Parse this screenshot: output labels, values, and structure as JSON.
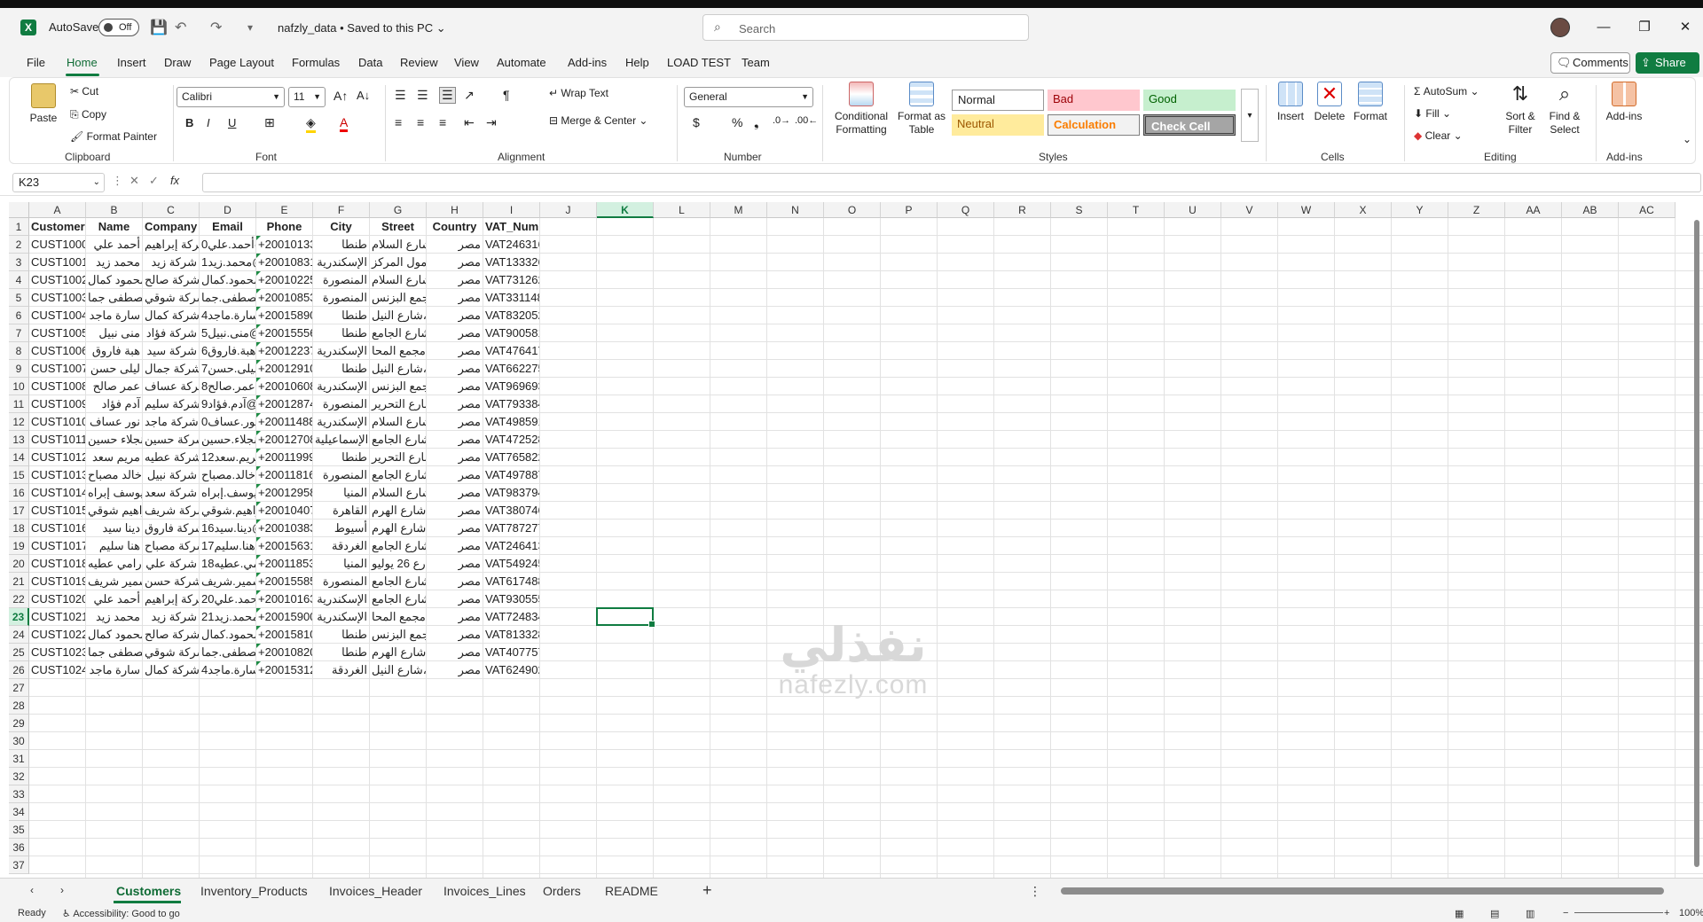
{
  "title_bar": {
    "autosave_label": "AutoSave",
    "autosave_state": "Off",
    "doc_title": "nafzly_data • Saved to this PC ⌄",
    "search_placeholder": "Search"
  },
  "menu": {
    "items": [
      "File",
      "Home",
      "Insert",
      "Draw",
      "Page Layout",
      "Formulas",
      "Data",
      "Review",
      "View",
      "Automate",
      "Add-ins",
      "Help",
      "LOAD TEST",
      "Team"
    ],
    "active": "Home",
    "comments": "Comments",
    "share": "Share"
  },
  "ribbon": {
    "clipboard": {
      "paste": "Paste",
      "cut": "Cut",
      "copy": "Copy",
      "format_painter": "Format Painter",
      "label": "Clipboard"
    },
    "font": {
      "name": "Calibri",
      "size": "11",
      "label": "Font"
    },
    "alignment": {
      "wrap": "Wrap Text",
      "merge": "Merge & Center",
      "label": "Alignment"
    },
    "number": {
      "format": "General",
      "label": "Number"
    },
    "styles": {
      "conditional": "Conditional Formatting",
      "format_as_table": "Format as Table",
      "normal": "Normal",
      "bad": "Bad",
      "good": "Good",
      "neutral": "Neutral",
      "calculation": "Calculation",
      "check_cell": "Check Cell",
      "label": "Styles"
    },
    "cells": {
      "insert": "Insert",
      "delete": "Delete",
      "format": "Format",
      "label": "Cells"
    },
    "editing": {
      "autosum": "AutoSum",
      "fill": "Fill",
      "clear": "Clear",
      "sort": "Sort & Filter",
      "find": "Find & Select",
      "label": "Editing"
    },
    "addins": {
      "addins": "Add-ins",
      "label": "Add-ins"
    }
  },
  "formula_bar": {
    "name_box": "K23",
    "formula": ""
  },
  "grid": {
    "columns": [
      "A",
      "B",
      "C",
      "D",
      "E",
      "F",
      "G",
      "H",
      "I",
      "J",
      "K",
      "L",
      "M",
      "N",
      "O",
      "P",
      "Q",
      "R",
      "S",
      "T",
      "U",
      "V",
      "W",
      "X",
      "Y",
      "Z",
      "AA",
      "AB",
      "AC"
    ],
    "row_numbers": [
      "1",
      "2",
      "3",
      "4",
      "5",
      "6",
      "7",
      "8",
      "9",
      "10",
      "11",
      "12",
      "13",
      "14",
      "15",
      "16",
      "17",
      "18",
      "19",
      "20",
      "21",
      "22",
      "23",
      "24",
      "25",
      "26",
      "27",
      "28",
      "29",
      "30",
      "31",
      "32",
      "33",
      "34",
      "35",
      "36",
      "37"
    ],
    "selected_cell": "K23",
    "headers": [
      "CustomerID",
      "Name",
      "Company",
      "Email",
      "Phone",
      "City",
      "Street",
      "Country",
      "VAT_Number"
    ],
    "rows": [
      [
        "CUST1000",
        "أحمد علي",
        "شركة إبراهيم",
        "أحمد.علي0@",
        "+20010133",
        "طنطا",
        "شارع السلام",
        "مصر",
        "VAT246316"
      ],
      [
        "CUST1001",
        "محمد زيد",
        "شركة زيد",
        "محمد.زيد1@",
        "+20010831",
        "الإسكندرية",
        "مول المركز",
        "مصر",
        "VAT133326"
      ],
      [
        "CUST1002",
        "محمود كمال",
        "شركة صالح",
        "محمود.كمال",
        "+20010225",
        "المنصورة",
        "شارع السلام",
        "مصر",
        "VAT731262"
      ],
      [
        "CUST1003",
        "مصطفى جما",
        "شركة شوقي",
        "مصطفى.جما",
        "+20010853",
        "المنصورة",
        "مجمع البزنس",
        "مصر",
        "VAT331148"
      ],
      [
        "CUST1004",
        "سارة ماجد",
        "شركة كمال",
        "سارة.ماجد4",
        "+20015890",
        "طنطا",
        "شارع النيل،",
        "مصر",
        "VAT832052"
      ],
      [
        "CUST1005",
        "منى نبيل",
        "شركة فؤاد",
        "منى.نبيل5@",
        "+20015556",
        "طنطا",
        "شارع الجامع",
        "مصر",
        "VAT900581"
      ],
      [
        "CUST1006",
        "هبة فاروق",
        "شركة سيد",
        "هبة.فاروق6",
        "+20012237",
        "الإسكندرية",
        "مجمع المحا",
        "مصر",
        "VAT476417"
      ],
      [
        "CUST1007",
        "ليلى حسن",
        "شركة جمال",
        "ليلى.حسن7",
        "+20012910",
        "طنطا",
        "شارع النيل،",
        "مصر",
        "VAT662275"
      ],
      [
        "CUST1008",
        "عمر صالح",
        "شركة عساف",
        "عمر.صالح8",
        "+20010608",
        "الإسكندرية",
        "مجمع البزنس",
        "مصر",
        "VAT969693"
      ],
      [
        "CUST1009",
        "آدم فؤاد",
        "شركة سليم",
        "آدم.فؤاد9@",
        "+20012874",
        "المنصورة",
        "شارع التحرير",
        "مصر",
        "VAT793384"
      ],
      [
        "CUST1010",
        "نور عساف",
        "شركة ماجد",
        "نور.عساف0",
        "+20011488",
        "الإسكندرية",
        "شارع السلام",
        "مصر",
        "VAT498591"
      ],
      [
        "CUST1011",
        "نجلاء حسين",
        "شركة حسين",
        "نجلاء.حسين",
        "+20012708",
        "الإسماعيلية",
        "شارع الجامع",
        "مصر",
        "VAT472528"
      ],
      [
        "CUST1012",
        "مريم سعد",
        "شركة عطيه",
        "مريم.سعد12",
        "+20011999",
        "طنطا",
        "شارع التحرير",
        "مصر",
        "VAT765822"
      ],
      [
        "CUST1013",
        "خالد مصباح",
        "شركة نبيل",
        "خالد.مصباح",
        "+20011816",
        "المنصورة",
        "شارع الجامع",
        "مصر",
        "VAT497887"
      ],
      [
        "CUST1014",
        "يوسف إبراه",
        "شركة سعد",
        "يوسف.إبراه",
        "+20012958",
        "المنيا",
        "شارع السلام",
        "مصر",
        "VAT983794"
      ],
      [
        "CUST1015",
        "إبراهيم شوقي",
        "شركة شريف",
        "إبراهيم.شوقي",
        "+20010407",
        "القاهرة",
        "شارع الهرم،",
        "مصر",
        "VAT380746"
      ],
      [
        "CUST1016",
        "دينا سيد",
        "شركة فاروق",
        "دينا.سيد16@",
        "+20010383",
        "أسيوط",
        "شارع الهرم،",
        "مصر",
        "VAT787277"
      ],
      [
        "CUST1017",
        "هنا سليم",
        "شركة مصباح",
        "هنا.سليم17",
        "+20015631",
        "الغردقة",
        "شارع الجامع",
        "مصر",
        "VAT246413"
      ],
      [
        "CUST1018",
        "رامي عطيه",
        "شركة علي",
        "رامي.عطيه18",
        "+20011853",
        "المنيا",
        "شارع 26 يوليو",
        "مصر",
        "VAT549245"
      ],
      [
        "CUST1019",
        "سمير شريف",
        "شركة حسن",
        "سمير.شريف",
        "+20015585",
        "المنصورة",
        "شارع الجامع",
        "مصر",
        "VAT617488"
      ],
      [
        "CUST1020",
        "أحمد علي",
        "شركة إبراهيم",
        "أحمد.علي20",
        "+20010163",
        "الإسكندرية",
        "شارع الجامع",
        "مصر",
        "VAT930555"
      ],
      [
        "CUST1021",
        "محمد زيد",
        "شركة زيد",
        "محمد.زيد21",
        "+20015900",
        "الإسكندرية",
        "مجمع المحا",
        "مصر",
        "VAT724834"
      ],
      [
        "CUST1022",
        "محمود كمال",
        "شركة صالح",
        "محمود.كمال",
        "+20015810",
        "طنطا",
        "مجمع البزنس",
        "مصر",
        "VAT813328"
      ],
      [
        "CUST1023",
        "مصطفى جما",
        "شركة شوقي",
        "مصطفى.جما",
        "+20010820",
        "طنطا",
        "شارع الهرم،",
        "مصر",
        "VAT407757"
      ],
      [
        "CUST1024",
        "سارة ماجد",
        "شركة كمال",
        "سارة.ماجد4",
        "+20015312",
        "الغردقة",
        "شارع النيل،",
        "مصر",
        "VAT624902"
      ]
    ]
  },
  "sheets": {
    "tabs": [
      "Customers",
      "Inventory_Products",
      "Invoices_Header",
      "Invoices_Lines",
      "Orders",
      "README"
    ],
    "active": "Customers"
  },
  "status": {
    "ready": "Ready",
    "accessibility": "Accessibility: Good to go",
    "zoom": "100%"
  },
  "watermark": {
    "arabic": "نفذلي",
    "english": "nafezly.com"
  }
}
